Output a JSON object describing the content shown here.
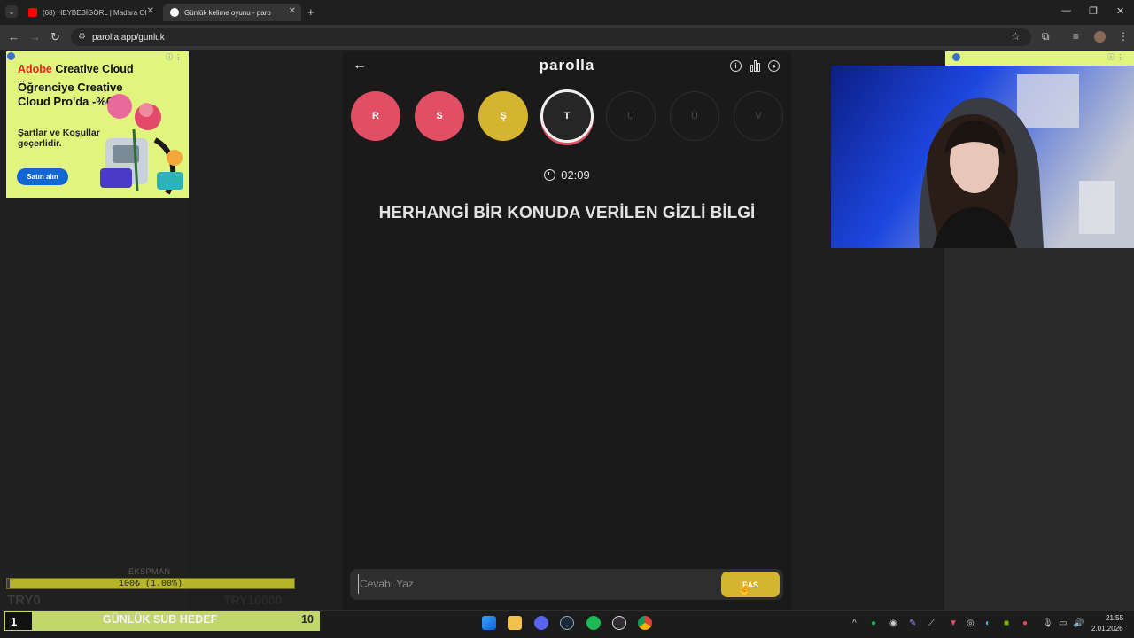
{
  "browser": {
    "tabs": [
      {
        "title": "(68) HEYBEBİGÖRL | Madara Ol",
        "favicon_color": "#ff0000"
      },
      {
        "title": "Günlük kelime oyunu - paro",
        "favicon_color": "#ffffff"
      }
    ],
    "url": "parolla.app/gunluk"
  },
  "ad": {
    "brand_red": "Adobe",
    "brand_rest": " Creative Cloud",
    "headline": "Öğrenciye Creative Cloud Pro'da -%60.",
    "terms": "Şartlar ve Koşullar geçerlidir.",
    "cta": "Satın alın",
    "info_icon": "info-icon"
  },
  "game": {
    "logo": "parolla",
    "letters": [
      {
        "char": "R",
        "state": "wrong"
      },
      {
        "char": "S",
        "state": "wrong"
      },
      {
        "char": "Ş",
        "state": "pass"
      },
      {
        "char": "T",
        "state": "current"
      },
      {
        "char": "U",
        "state": "pending"
      },
      {
        "char": "Ü",
        "state": "pending"
      },
      {
        "char": "V",
        "state": "pending"
      }
    ],
    "timer": "02:09",
    "question": "HERHANGİ BİR KONUDA VERİLEN GİZLİ BİLGİ",
    "answer_placeholder": "Cevabı Yaz",
    "pass_label": "PAS",
    "colors": {
      "wrong": "#e24e63",
      "pass": "#d5b42f"
    }
  },
  "overlay": {
    "expert_label": "EKSPMAN",
    "progress_text": "100₺ (1.00%)",
    "progress_fraction": 0.01,
    "goal_min": "TRY0",
    "goal_max": "TRY10000",
    "sub_count": "1",
    "sub_title": "GÜNLÜK SUB HEDEF",
    "sub_target": "10"
  },
  "taskbar": {
    "time": "21:55",
    "date": "2.01.2026"
  }
}
